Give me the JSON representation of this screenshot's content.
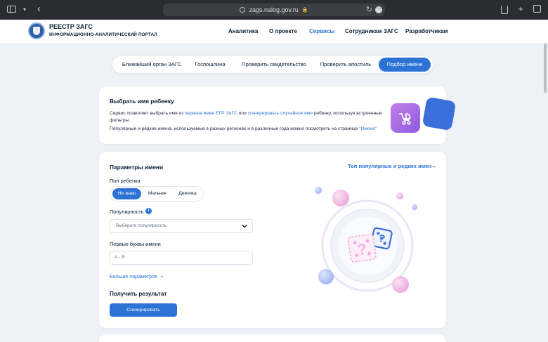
{
  "browser": {
    "url": "zags.nalog.gov.ru"
  },
  "header": {
    "brand_title": "РЕЕСТР ЗАГС",
    "brand_subtitle": "ИНФОРМАЦИОННО-АНАЛИТИЧЕСКИЙ ПОРТАЛ",
    "nav": [
      {
        "label": "Аналитика",
        "active": false
      },
      {
        "label": "О проекте",
        "active": false
      },
      {
        "label": "Сервисы",
        "active": true
      },
      {
        "label": "Сотрудникам ЗАГС",
        "active": false
      },
      {
        "label": "Разработчикам",
        "active": false
      }
    ]
  },
  "tabs": [
    {
      "label": "Ближайший орган ЗАГС",
      "active": false
    },
    {
      "label": "Госпошлина",
      "active": false
    },
    {
      "label": "Проверить свидетельство",
      "active": false
    },
    {
      "label": "Проверить апостиль",
      "active": false
    },
    {
      "label": "Подбор имени",
      "active": true
    }
  ],
  "intro": {
    "title": "Выбрать имя ребенку",
    "line1_prefix": "Сервис позволяет выбрать имя из ",
    "line1_link1": "перечня имен ЕГР ЗАГС",
    "line1_mid": " или ",
    "line1_link2": "сгенерировать случайное имя",
    "line1_suffix": " ребенку, используя встроенные",
    "line2": "фильтры.",
    "line3_prefix": "Популярные и редкие имена, используемые в разных регионах и в различные года можно посмотреть на странице ",
    "line3_link": "\"Имена\""
  },
  "params": {
    "title": "Параметры имени",
    "top_link": "Топ популярных и редких имен",
    "gender_label": "Пол ребенка",
    "gender_options": [
      {
        "label": "Не знаю",
        "active": true
      },
      {
        "label": "Мальчик",
        "active": false
      },
      {
        "label": "Девочка",
        "active": false
      }
    ],
    "popularity_label": "Популярность",
    "popularity_info": "i",
    "popularity_placeholder": "Выберите популярность",
    "letters_label": "Первые буквы имени",
    "letters_value": "А - Я",
    "more_params": "Больше параметров",
    "result_title": "Получить результат",
    "generate_button": "Сгенерировать"
  },
  "colors": {
    "accent": "#2d73d6",
    "background": "#eef1f6",
    "card": "#ffffff",
    "text": "#0b1f33"
  }
}
